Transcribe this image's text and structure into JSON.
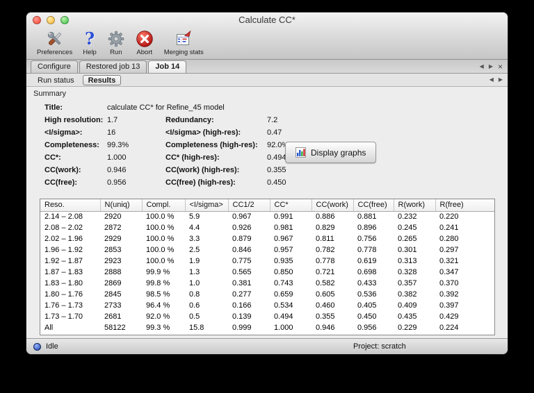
{
  "window": {
    "title": "Calculate CC*"
  },
  "toolbar": {
    "preferences": "Preferences",
    "help": "Help",
    "run": "Run",
    "abort": "Abort",
    "merging_stats": "Merging stats"
  },
  "tabs": {
    "configure": "Configure",
    "restored_job": "Restored job 13",
    "job": "Job 14"
  },
  "subtabs": {
    "run_status": "Run status",
    "results": "Results"
  },
  "icons": {
    "back_arrow": "◀",
    "forward_arrow": "▶",
    "close": "×"
  },
  "sections": {
    "summary": "Summary"
  },
  "summary": {
    "display_graphs": "Display graphs",
    "rows": [
      {
        "l1": "Title:",
        "v1": "calculate CC* for Refine_45 model",
        "l2": "",
        "v2": ""
      },
      {
        "l1": "High resolution:",
        "v1": "1.7",
        "l2": "Redundancy:",
        "v2": "7.2"
      },
      {
        "l1": "<I/sigma>:",
        "v1": "16",
        "l2": "<I/sigma> (high-res):",
        "v2": "0.47"
      },
      {
        "l1": "Completeness:",
        "v1": "99.3%",
        "l2": "Completeness (high-res):",
        "v2": "92.0%"
      },
      {
        "l1": "CC*:",
        "v1": "1.000",
        "l2": "CC* (high-res):",
        "v2": "0.494"
      },
      {
        "l1": "CC(work):",
        "v1": "0.946",
        "l2": "CC(work) (high-res):",
        "v2": "0.355"
      },
      {
        "l1": "CC(free):",
        "v1": "0.956",
        "l2": "CC(free) (high-res):",
        "v2": "0.450"
      }
    ]
  },
  "table": {
    "columns": [
      "Reso.",
      "N(uniq)",
      "Compl.",
      "<I/sigma>",
      "CC1/2",
      "CC*",
      "CC(work)",
      "CC(free)",
      "R(work)",
      "R(free)"
    ],
    "rows": [
      [
        "2.14 – 2.08",
        "2920",
        "100.0 %",
        "5.9",
        "0.967",
        "0.991",
        "0.886",
        "0.881",
        "0.232",
        "0.220"
      ],
      [
        "2.08 – 2.02",
        "2872",
        "100.0 %",
        "4.4",
        "0.926",
        "0.981",
        "0.829",
        "0.896",
        "0.245",
        "0.241"
      ],
      [
        "2.02 – 1.96",
        "2929",
        "100.0 %",
        "3.3",
        "0.879",
        "0.967",
        "0.811",
        "0.756",
        "0.265",
        "0.280"
      ],
      [
        "1.96 – 1.92",
        "2853",
        "100.0 %",
        "2.5",
        "0.846",
        "0.957",
        "0.782",
        "0.778",
        "0.301",
        "0.297"
      ],
      [
        "1.92 – 1.87",
        "2923",
        "100.0 %",
        "1.9",
        "0.775",
        "0.935",
        "0.778",
        "0.619",
        "0.313",
        "0.321"
      ],
      [
        "1.87 – 1.83",
        "2888",
        "99.9 %",
        "1.3",
        "0.565",
        "0.850",
        "0.721",
        "0.698",
        "0.328",
        "0.347"
      ],
      [
        "1.83 – 1.80",
        "2869",
        "99.8 %",
        "1.0",
        "0.381",
        "0.743",
        "0.582",
        "0.433",
        "0.357",
        "0.370"
      ],
      [
        "1.80 – 1.76",
        "2845",
        "98.5 %",
        "0.8",
        "0.277",
        "0.659",
        "0.605",
        "0.536",
        "0.382",
        "0.392"
      ],
      [
        "1.76 – 1.73",
        "2733",
        "96.4 %",
        "0.6",
        "0.166",
        "0.534",
        "0.460",
        "0.405",
        "0.409",
        "0.397"
      ],
      [
        "1.73 – 1.70",
        "2681",
        "92.0 %",
        "0.5",
        "0.139",
        "0.494",
        "0.355",
        "0.450",
        "0.435",
        "0.429"
      ],
      [
        "All",
        "58122",
        "99.3 %",
        "15.8",
        "0.999",
        "1.000",
        "0.946",
        "0.956",
        "0.229",
        "0.224"
      ]
    ]
  },
  "statusbar": {
    "status": "Idle",
    "project": "Project: scratch"
  }
}
